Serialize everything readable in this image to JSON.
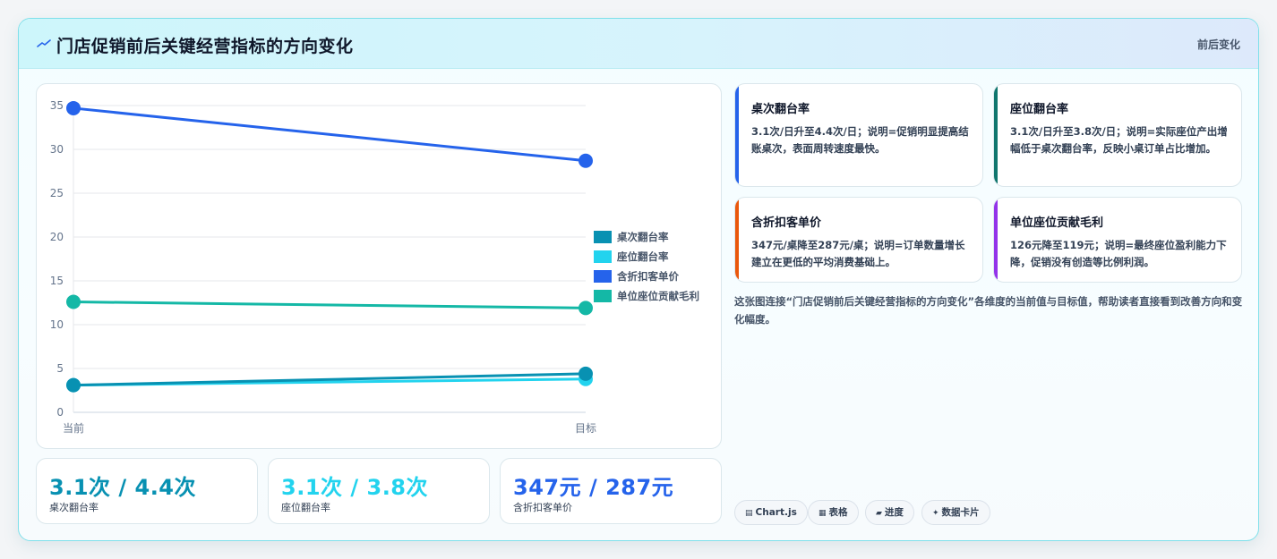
{
  "header": {
    "title": "门店促销前后关键经营指标的方向变化",
    "badge": "前后变化",
    "icon": "trend-line-icon"
  },
  "chart_data": {
    "type": "line",
    "categories": [
      "当前",
      "目标"
    ],
    "ylim": [
      0,
      35
    ],
    "yticks": [
      0,
      5,
      10,
      15,
      20,
      25,
      30,
      35
    ],
    "grid": true,
    "legend_position": "right",
    "series": [
      {
        "name": "桌次翻台率",
        "values": [
          3.1,
          4.4
        ],
        "color": "#0891b2"
      },
      {
        "name": "座位翻台率",
        "values": [
          3.1,
          3.8
        ],
        "color": "#22d3ee"
      },
      {
        "name": "含折扣客单价",
        "values": [
          34.7,
          28.7
        ],
        "color": "#2563eb"
      },
      {
        "name": "单位座位贡献毛利",
        "values": [
          12.6,
          11.9
        ],
        "color": "#14b8a6"
      }
    ]
  },
  "stats": [
    {
      "value": "3.1次 / 4.4次",
      "label": "桌次翻台率",
      "color": "#0891b2"
    },
    {
      "value": "3.1次 / 3.8次",
      "label": "座位翻台率",
      "color": "#22d3ee"
    },
    {
      "value": "347元 / 287元",
      "label": "含折扣客单价",
      "color": "#2563eb"
    }
  ],
  "insights": [
    {
      "title": "桌次翻台率",
      "body": "3.1次/日升至4.4次/日；说明=促销明显提高结账桌次，表面周转速度最快。",
      "color": "#2563eb"
    },
    {
      "title": "座位翻台率",
      "body": "3.1次/日升至3.8次/日；说明=实际座位产出增幅低于桌次翻台率，反映小桌订单占比增加。",
      "color": "#0f766e"
    },
    {
      "title": "含折扣客单价",
      "body": "347元/桌降至287元/桌；说明=订单数量增长建立在更低的平均消费基础上。",
      "color": "#ea580c"
    },
    {
      "title": "单位座位贡献毛利",
      "body": "126元降至119元；说明=最终座位盈利能力下降，促销没有创造等比例利润。",
      "color": "#9333ea"
    }
  ],
  "description": "这张图连接“门店促销前后关键经营指标的方向变化”各维度的当前值与目标值，帮助读者直接看到改善方向和变化幅度。",
  "tags": [
    {
      "icon": "chart-icon",
      "glyph": "▤",
      "label": "Chart.js"
    },
    {
      "icon": "table-icon",
      "glyph": "▦",
      "label": "表格"
    },
    {
      "icon": "progress-icon",
      "glyph": "▰",
      "label": "进度"
    },
    {
      "icon": "sparkle-icon",
      "glyph": "✦",
      "label": "数据卡片"
    }
  ]
}
